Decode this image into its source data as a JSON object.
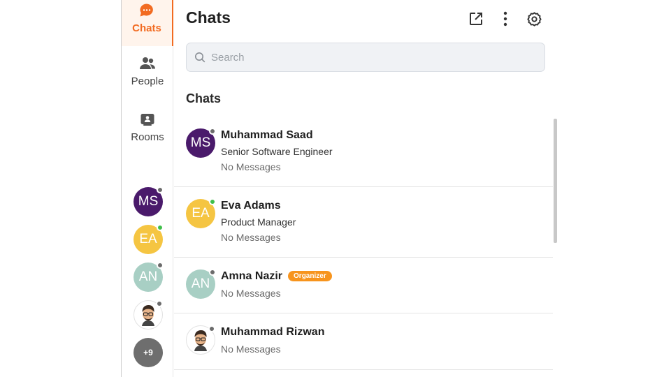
{
  "rail": {
    "chats_label": "Chats",
    "people_label": "People",
    "rooms_label": "Rooms",
    "avatars": [
      {
        "initials": "MS",
        "color": "#4a1a6b",
        "status": "offline"
      },
      {
        "initials": "EA",
        "color": "#f5c542",
        "status": "online"
      },
      {
        "initials": "AN",
        "color": "#a8cfc4",
        "status": "offline"
      },
      {
        "initials": "",
        "color": "#ffffff",
        "status": "offline",
        "type": "cartoon"
      }
    ],
    "more_label": "+9"
  },
  "header": {
    "title": "Chats",
    "icons": [
      "external-link-icon",
      "more-vertical-icon",
      "settings-gear-icon"
    ]
  },
  "search": {
    "placeholder": "Search",
    "value": ""
  },
  "section_title": "Chats",
  "chats": [
    {
      "name": "Muhammad Saad",
      "initials": "MS",
      "role": "Senior Software Engineer",
      "message": "No Messages",
      "color": "#4a1a6b",
      "status": "offline"
    },
    {
      "name": "Eva Adams",
      "initials": "EA",
      "role": "Product Manager",
      "message": "No Messages",
      "color": "#f5c542",
      "status": "online"
    },
    {
      "name": "Amna Nazir",
      "initials": "AN",
      "role": "",
      "badge": "Organizer",
      "message": "No Messages",
      "color": "#a8cfc4",
      "status": "offline"
    },
    {
      "name": "Muhammad Rizwan",
      "initials": "",
      "role": "",
      "message": "No Messages",
      "color": "#ffffff",
      "status": "offline",
      "type": "cartoon"
    }
  ],
  "colors": {
    "accent": "#f26b21",
    "online": "#3fbf4a",
    "offline": "#6b6b6b",
    "badge": "#f7941d"
  }
}
